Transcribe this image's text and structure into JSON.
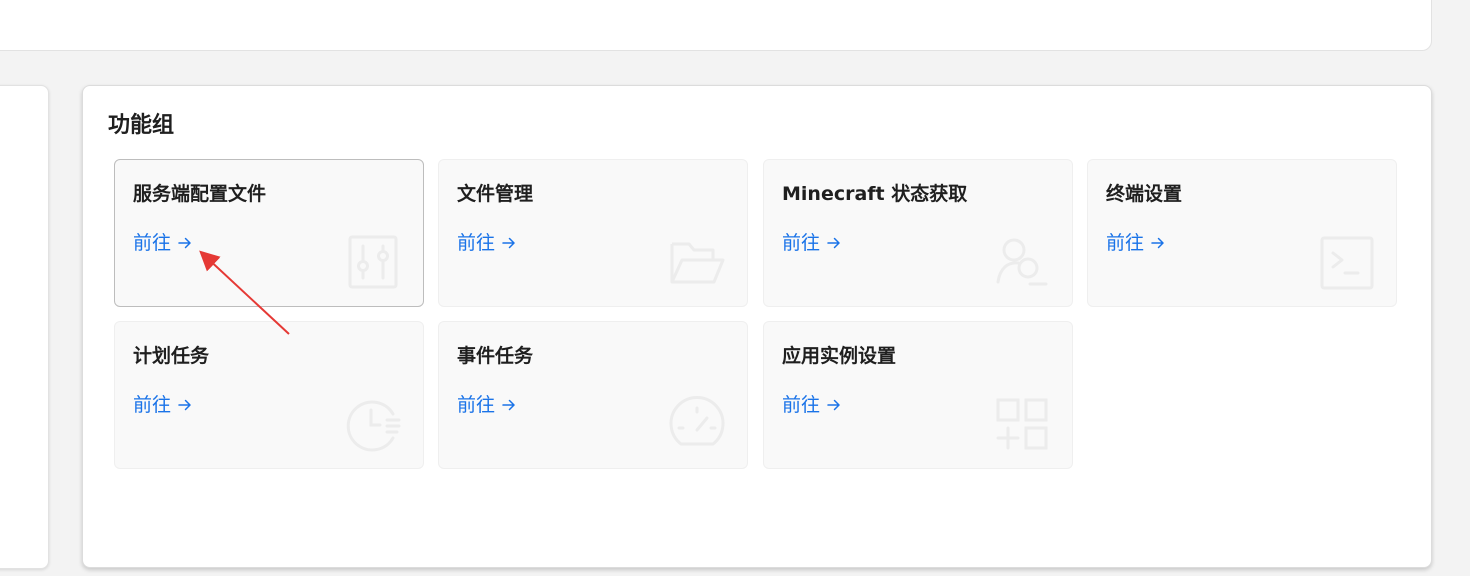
{
  "section": {
    "title": "功能组"
  },
  "cards": [
    {
      "title": "服务端配置文件",
      "link": "前往",
      "icon": "sliders-icon"
    },
    {
      "title": "文件管理",
      "link": "前往",
      "icon": "folder-open-icon"
    },
    {
      "title": "Minecraft 状态获取",
      "link": "前往",
      "icon": "user-search-icon"
    },
    {
      "title": "终端设置",
      "link": "前往",
      "icon": "terminal-icon"
    },
    {
      "title": "计划任务",
      "link": "前往",
      "icon": "clock-list-icon"
    },
    {
      "title": "事件任务",
      "link": "前往",
      "icon": "speedometer-icon"
    },
    {
      "title": "应用实例设置",
      "link": "前往",
      "icon": "grid-add-icon"
    }
  ],
  "colors": {
    "link": "#1a73e8",
    "annotation_arrow": "#e53935"
  }
}
